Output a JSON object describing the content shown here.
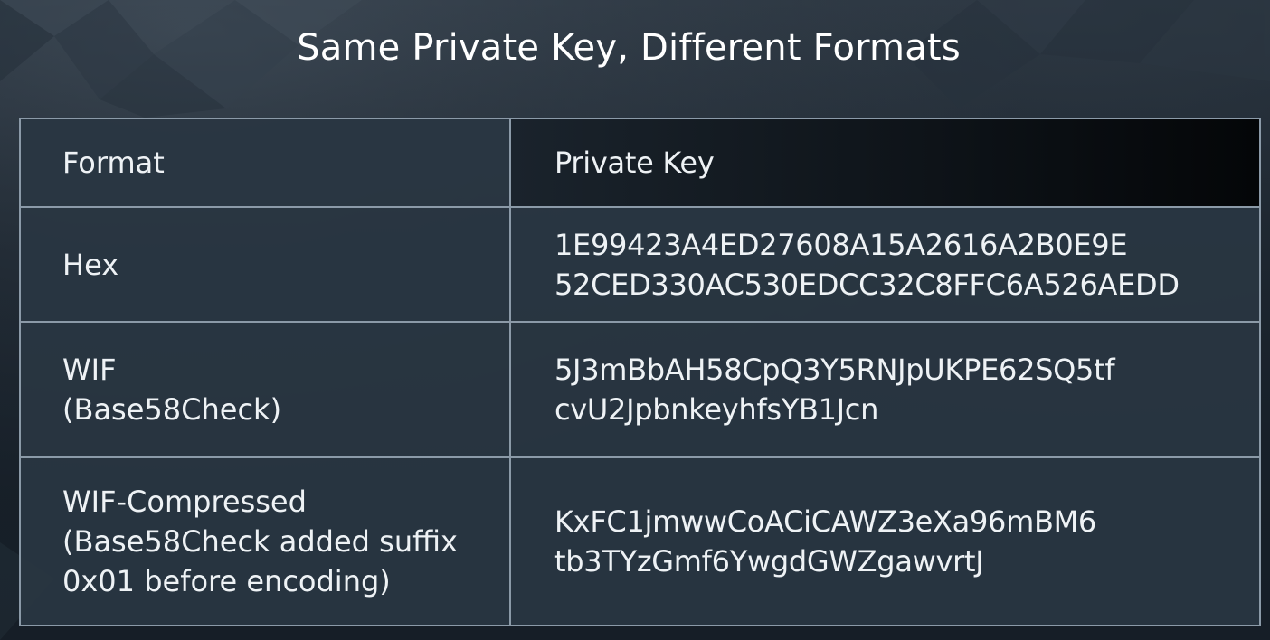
{
  "slide": {
    "title": "Same Private Key, Different Formats"
  },
  "table": {
    "headers": {
      "format": "Format",
      "private_key": "Private Key"
    },
    "rows": [
      {
        "format_lines": [
          "Hex"
        ],
        "key_lines": [
          "1E99423A4ED27608A15A2616A2B0E9E",
          "52CED330AC530EDCC32C8FFC6A526AEDD"
        ]
      },
      {
        "format_lines": [
          "WIF",
          "(Base58Check)"
        ],
        "key_lines": [
          "5J3mBbAH58CpQ3Y5RNJpUKPE62SQ5tf",
          "cvU2JpbnkeyhfsYB1Jcn"
        ]
      },
      {
        "format_lines": [
          "WIF-Compressed",
          "(Base58Check added suffix",
          "0x01 before encoding)"
        ],
        "key_lines": [
          "KxFC1jmwwCoACiCAWZ3eXa96mBM6",
          "tb3TYzGmf6YwgdGWZgawvrtJ"
        ]
      }
    ]
  },
  "colors": {
    "background": "#1f2832",
    "cell_fill": "#293642",
    "header_key_fill": "#050709",
    "grid_line": "#8b9aa8",
    "text": "#ffffff"
  }
}
